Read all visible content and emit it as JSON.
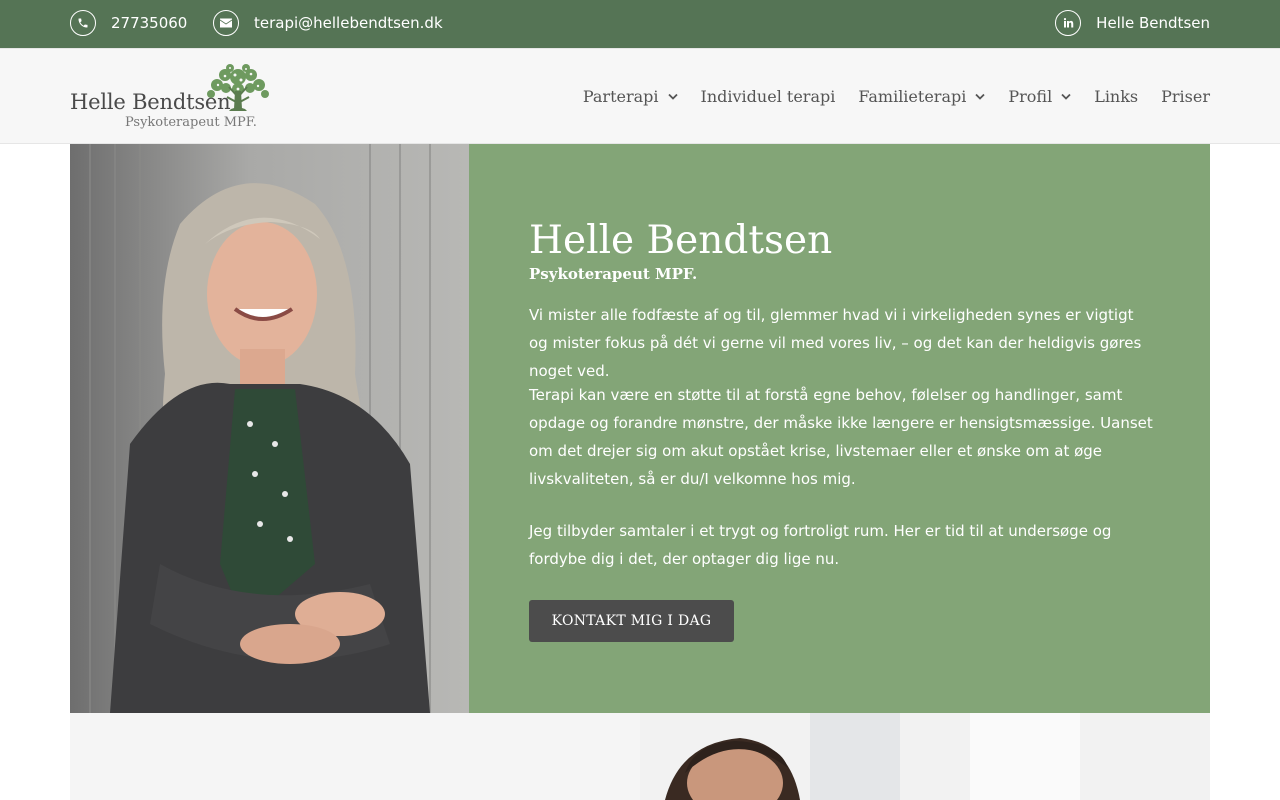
{
  "topbar": {
    "phone": "27735060",
    "email": "terapi@hellebendtsen.dk",
    "social_label": "Helle Bendtsen",
    "icons": {
      "phone": "phone-icon",
      "email": "envelope-icon",
      "social": "linkedin-icon"
    }
  },
  "logo": {
    "name": "Helle Bendtsen",
    "subtitle": "Psykoterapeut MPF."
  },
  "nav": {
    "items": [
      {
        "label": "Parterapi",
        "has_dropdown": true
      },
      {
        "label": "Individuel terapi",
        "has_dropdown": false
      },
      {
        "label": "Familieterapi",
        "has_dropdown": true
      },
      {
        "label": "Profil",
        "has_dropdown": true
      },
      {
        "label": "Links",
        "has_dropdown": false
      },
      {
        "label": "Priser",
        "has_dropdown": false
      }
    ]
  },
  "hero": {
    "title": "Helle Bendtsen",
    "subtitle": "Psykoterapeut MPF.",
    "paragraphs": [
      "Vi mister alle fodfæste af og til, glemmer hvad vi i virkeligheden synes er vigtigt og mister fokus på dét vi gerne vil med vores liv, – og det kan der heldigvis gøres noget ved.",
      "Terapi kan være en støtte til at forstå egne behov, følelser og handlinger, samt opdage og forandre mønstre, der måske ikke længere er hensigtsmæssige. Uanset om det drejer sig om akut opstået krise, livstemaer eller et  ønske om at øge livskvaliteten, så er du/I velkomne hos mig.",
      "Jeg tilbyder samtaler i et trygt og fortroligt rum. Her er tid til at undersøge og fordybe dig i det, der optager dig lige nu."
    ],
    "cta_label": "KONTAKT MIG I DAG"
  },
  "colors": {
    "topbar": "#557455",
    "header": "#f7f7f7",
    "hero_panel": "#83a577",
    "cta": "#4c4c4c",
    "logo_green": "#6e9a5f"
  }
}
